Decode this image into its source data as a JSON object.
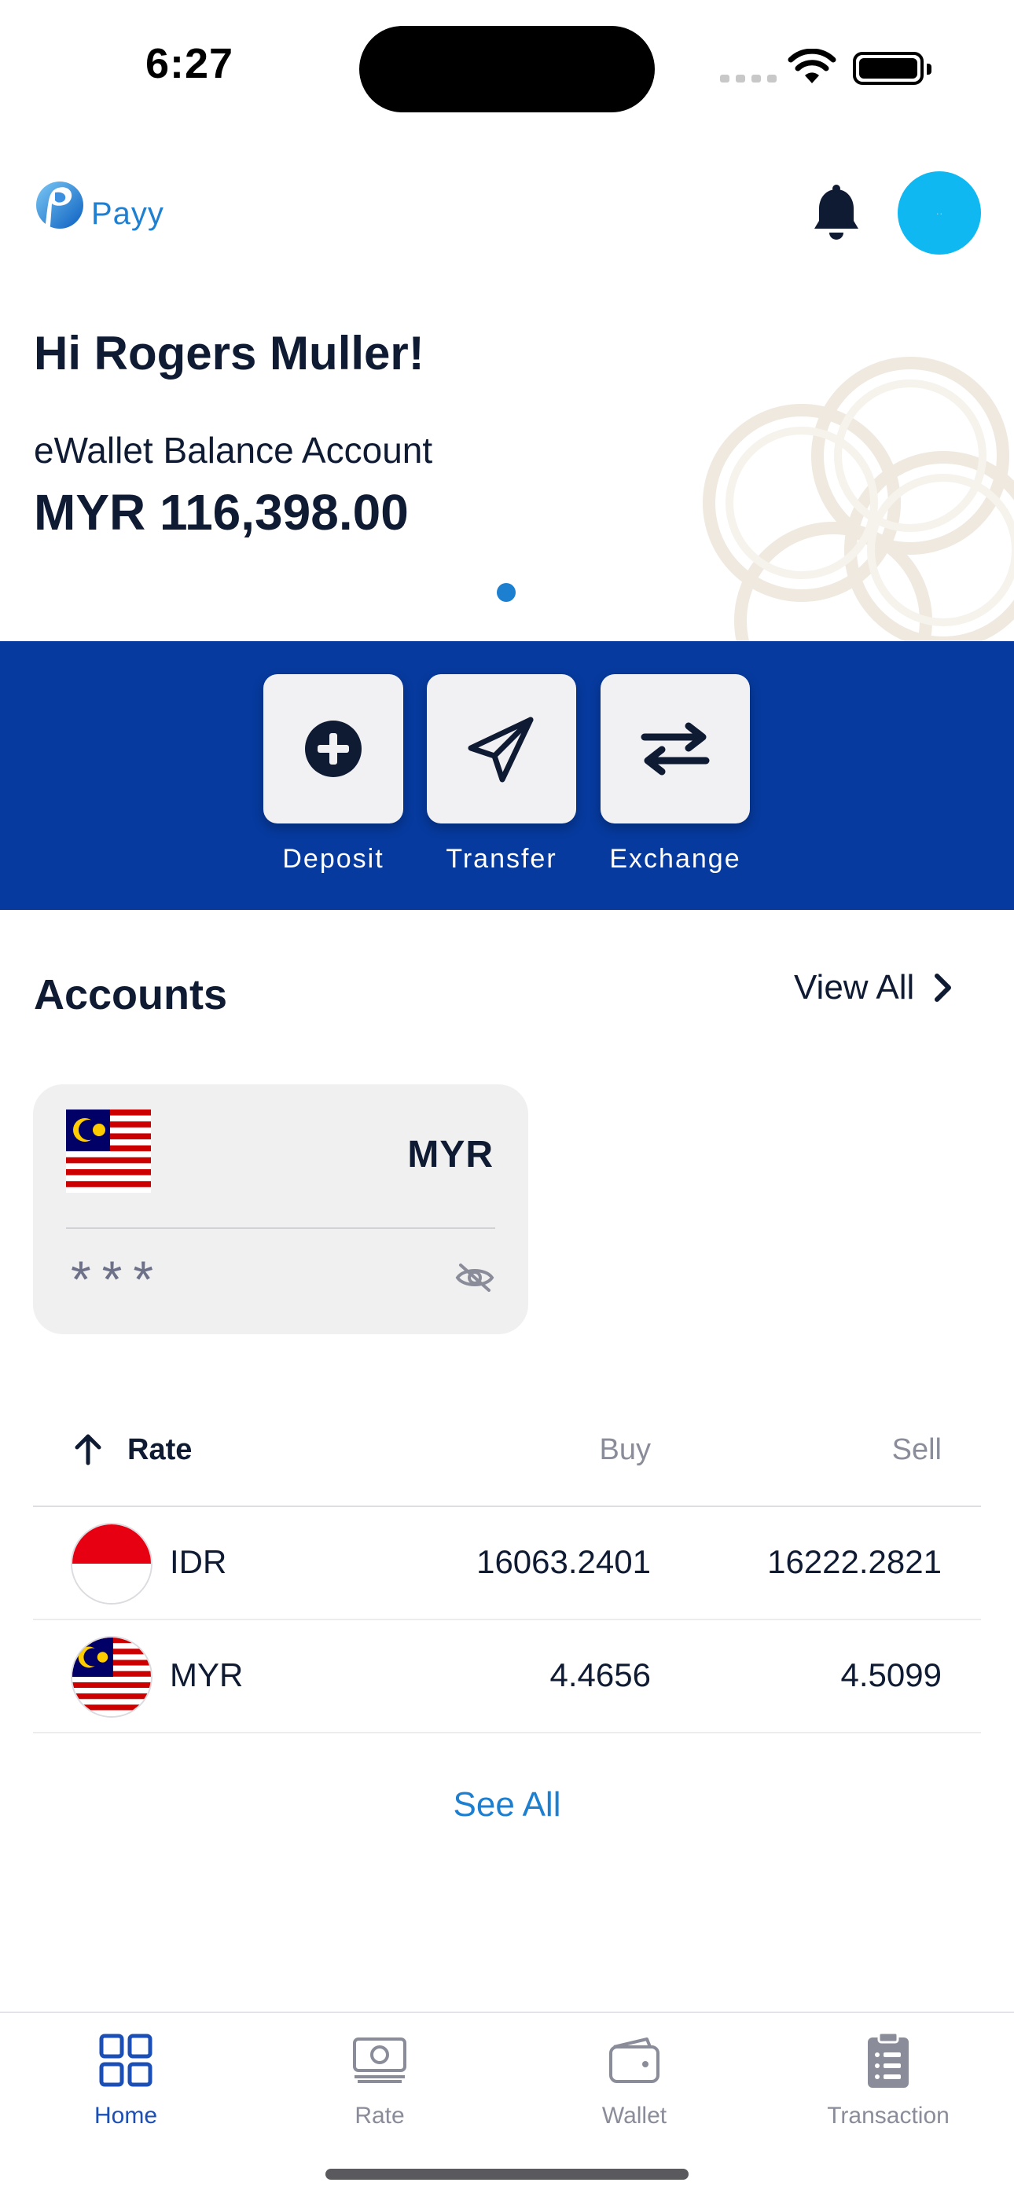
{
  "status_bar": {
    "time": "6:27"
  },
  "header": {
    "logo_text": "Payy",
    "icons": {
      "bell": "bell-icon",
      "avatar": "avatar"
    }
  },
  "hero": {
    "greeting": "Hi Rogers Muller!",
    "balance_label": "eWallet Balance Account",
    "balance_value": "MYR 116,398.00"
  },
  "actions": [
    {
      "label": "Deposit",
      "icon": "plus-circle-icon"
    },
    {
      "label": "Transfer",
      "icon": "paper-plane-icon"
    },
    {
      "label": "Exchange",
      "icon": "swap-arrows-icon"
    }
  ],
  "accounts": {
    "title": "Accounts",
    "view_all": "View All",
    "card": {
      "currency": "MYR",
      "masked_balance": "***",
      "flag": "malaysia-flag"
    }
  },
  "rates": {
    "headers": {
      "rate": "Rate",
      "buy": "Buy",
      "sell": "Sell"
    },
    "rows": [
      {
        "code": "IDR",
        "buy": "16063.2401",
        "sell": "16222.2821",
        "flag": "indonesia-flag"
      },
      {
        "code": "MYR",
        "buy": "4.4656",
        "sell": "4.5099",
        "flag": "malaysia-flag"
      }
    ],
    "see_all": "See All"
  },
  "tab_bar": {
    "tabs": [
      {
        "label": "Home",
        "icon": "grid-icon",
        "active": true
      },
      {
        "label": "Rate",
        "icon": "cash-icon",
        "active": false
      },
      {
        "label": "Wallet",
        "icon": "wallet-icon",
        "active": false
      },
      {
        "label": "Transaction",
        "icon": "clipboard-list-icon",
        "active": false
      }
    ]
  },
  "colors": {
    "primary_blue": "#063a9e",
    "accent_blue": "#1c7fd0",
    "avatar_cyan": "#10b8f2",
    "text_dark": "#0f1a33"
  }
}
